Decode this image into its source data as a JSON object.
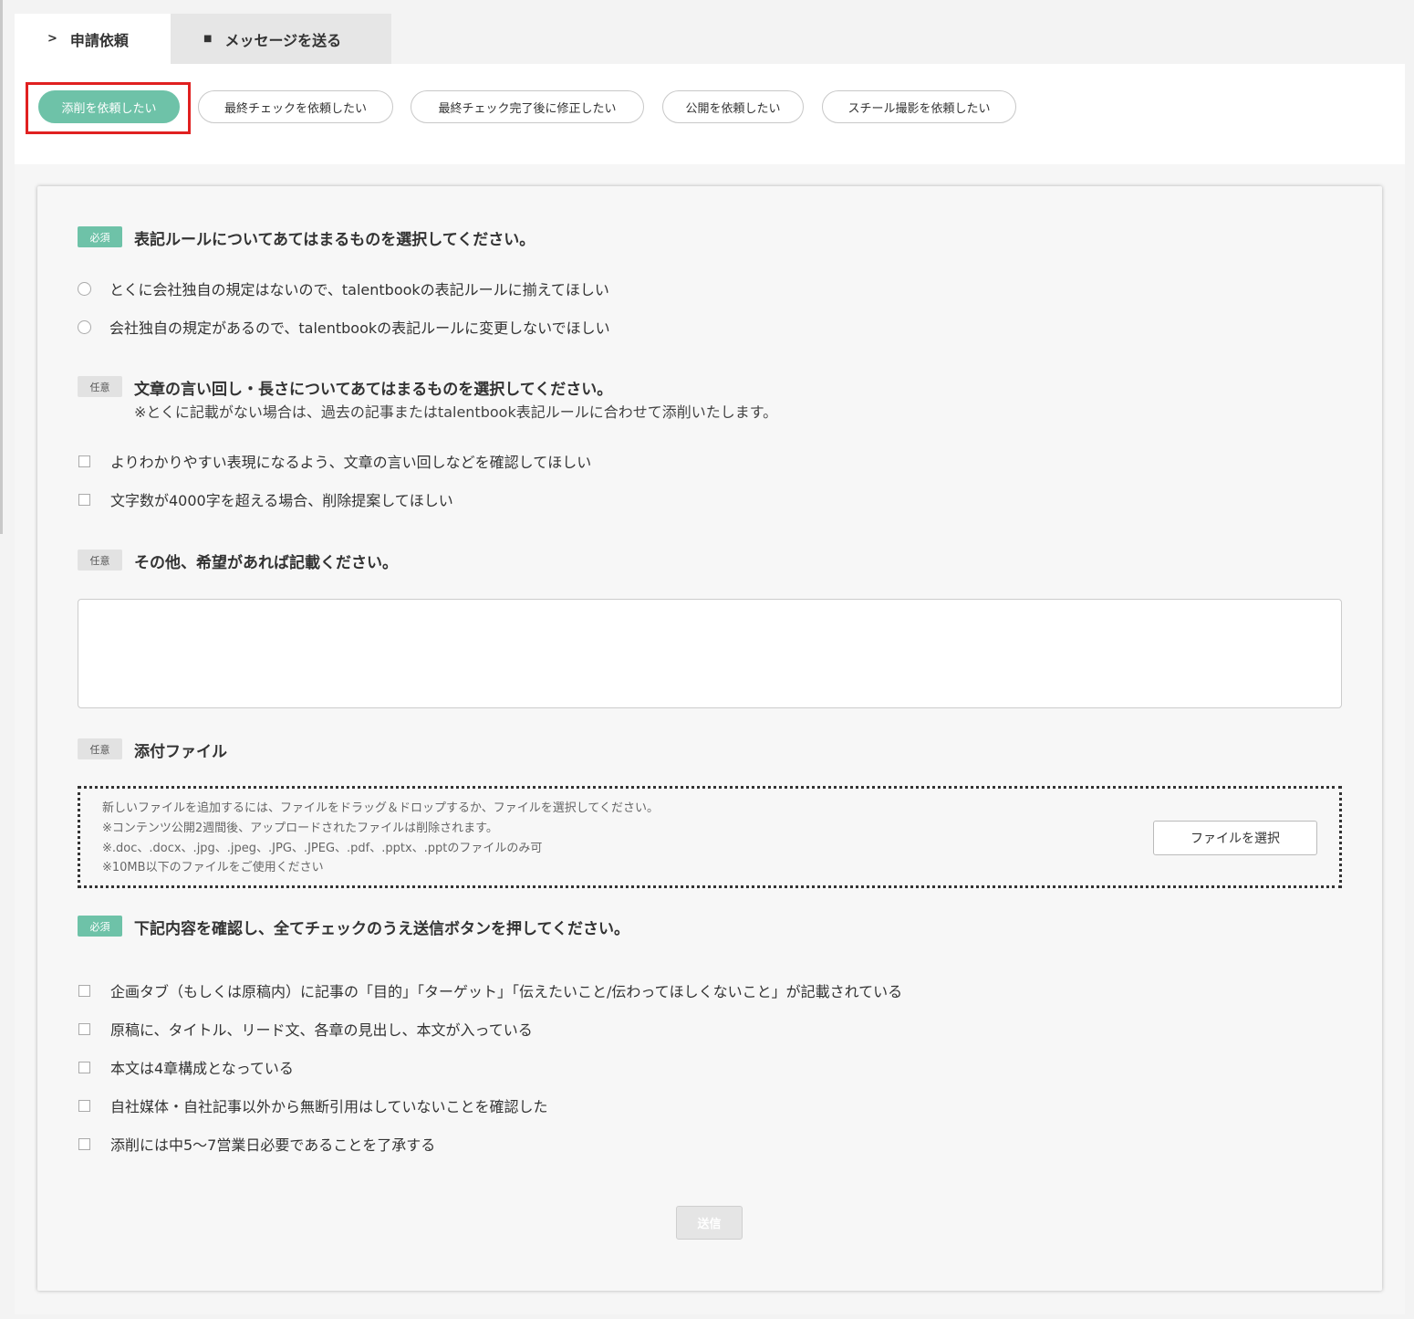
{
  "tabs": {
    "request": {
      "icon": "send-icon",
      "label": "申請依頼"
    },
    "message": {
      "icon": "square-icon",
      "label": "メッセージを送る"
    }
  },
  "request_types": [
    {
      "label": "添削を依頼したい",
      "selected": true
    },
    {
      "label": "最終チェックを依頼したい",
      "selected": false
    },
    {
      "label": "最終チェック完了後に修正したい",
      "selected": false
    },
    {
      "label": "公開を依頼したい",
      "selected": false
    },
    {
      "label": "スチール撮影を依頼したい",
      "selected": false
    }
  ],
  "badges": {
    "required": "必須",
    "optional": "任意"
  },
  "section1": {
    "question": "表記ルールについてあてはまるものを選択してください。",
    "options": [
      "とくに会社独自の規定はないので、talentbookの表記ルールに揃えてほしい",
      "会社独自の規定があるので、talentbookの表記ルールに変更しないでほしい"
    ]
  },
  "section2": {
    "question": "文章の言い回し・長さについてあてはまるものを選択してください。",
    "note": "※とくに記載がない場合は、過去の記事またはtalentbook表記ルールに合わせて添削いたします。",
    "options": [
      "よりわかりやすい表現になるよう、文章の言い回しなどを確認してほしい",
      "文字数が4000字を超える場合、削除提案してほしい"
    ]
  },
  "section3": {
    "question": "その他、希望があれば記載ください。",
    "textarea_value": ""
  },
  "section4": {
    "question": "添付ファイル",
    "dropzone_lines": [
      "新しいファイルを追加するには、ファイルをドラッグ＆ドロップするか、ファイルを選択してください。",
      "※コンテンツ公開2週間後、アップロードされたファイルは削除されます。",
      "※.doc、.docx、.jpg、.jpeg、.JPG、.JPEG、.pdf、.pptx、.pptのファイルのみ可",
      "※10MB以下のファイルをご使用ください"
    ],
    "file_button": "ファイルを選択"
  },
  "section5": {
    "question": "下記内容を確認し、全てチェックのうえ送信ボタンを押してください。",
    "options": [
      "企画タブ（もしくは原稿内）に記事の「目的」「ターゲット」「伝えたいこと/伝わってほしくないこと」が記載されている",
      "原稿に、タイトル、リード文、各章の見出し、本文が入っている",
      "本文は4章構成となっている",
      "自社媒体・自社記事以外から無断引用はしていないことを確認した",
      "添削には中5〜7営業日必要であることを了承する"
    ]
  },
  "submit_label": "送信",
  "colors": {
    "accent": "#6ec2a8",
    "highlight": "#e02020"
  }
}
